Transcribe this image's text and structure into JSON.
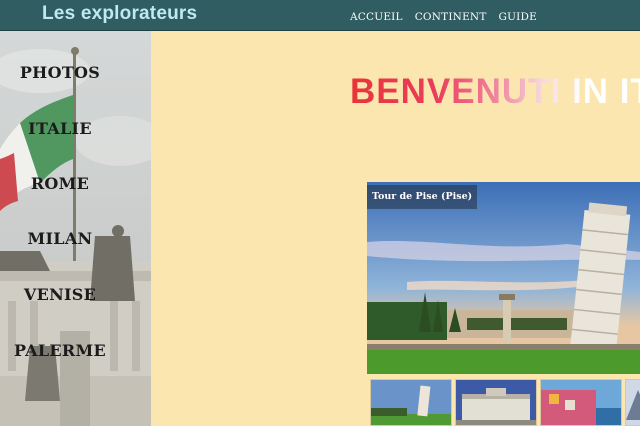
{
  "header": {
    "brand": "Les explorateurs",
    "nav": [
      "ACCUEIL",
      "CONTINENT",
      "GUIDE"
    ]
  },
  "sidebar": {
    "links": [
      "PHOTOS",
      "ITALIE",
      "ROME",
      "MILAN",
      "VENISE",
      "PALERME"
    ]
  },
  "main": {
    "headline": "BENVENUTI IN ITALIA",
    "photo_caption": "Tour de Pise (Pise)",
    "thumbnail_count": 4
  },
  "colors": {
    "topbar": "#2f5d62",
    "brand_text": "#bfe8f0",
    "page_background": "#fbe6b0",
    "headline_start": "#e8343a"
  }
}
